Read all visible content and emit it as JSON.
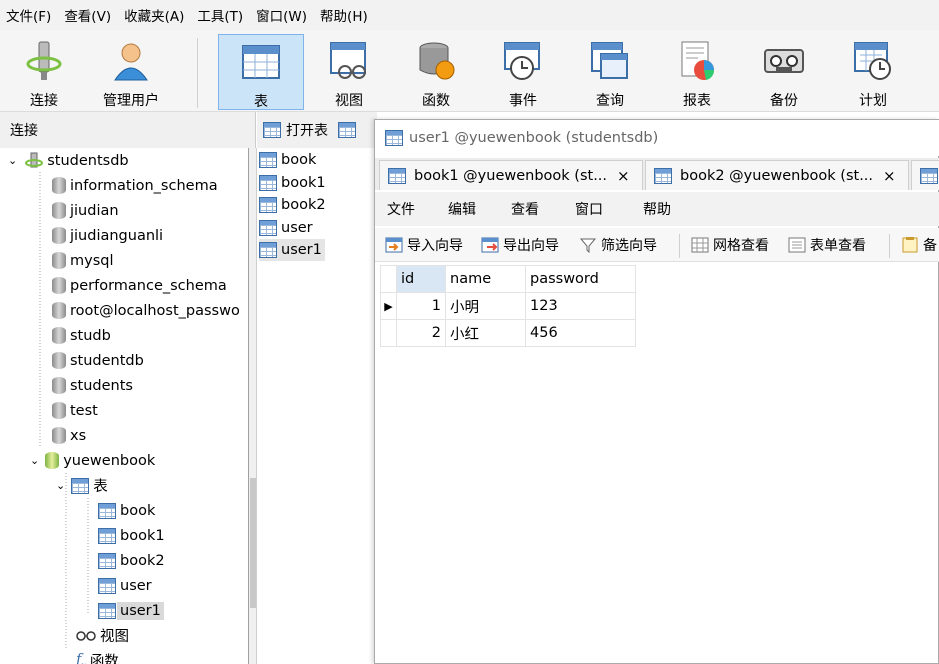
{
  "menubar": [
    "文件(F)",
    "查看(V)",
    "收藏夹(A)",
    "工具(T)",
    "窗口(W)",
    "帮助(H)"
  ],
  "toolbar": {
    "connect": "连接",
    "users": "管理用户",
    "table": "表",
    "view": "视图",
    "function": "函数",
    "event": "事件",
    "query": "查询",
    "report": "报表",
    "backup": "备份",
    "schedule": "计划"
  },
  "sidebar": {
    "header": "连接",
    "connection": "studentsdb",
    "databases": [
      "information_schema",
      "jiudian",
      "jiudianguanli",
      "mysql",
      "performance_schema",
      "root@localhost_passwo",
      "studb",
      "studentdb",
      "students",
      "test",
      "xs"
    ],
    "open_db": "yuewenbook",
    "tables_folder": "表",
    "tables": [
      "book",
      "book1",
      "book2",
      "user",
      "user1"
    ],
    "views_folder": "视图",
    "functions_folder": "函数"
  },
  "objbar": {
    "open_table": "打开表"
  },
  "objlist": [
    "book",
    "book1",
    "book2",
    "user",
    "user1"
  ],
  "window": {
    "title": "user1 @yuewenbook (studentsdb)",
    "tabs": [
      {
        "label": "book1 @yuewenbook (st..."
      },
      {
        "label": "book2 @yuewenbook (st..."
      }
    ],
    "tab_close": "×",
    "menu": [
      "文件",
      "编辑",
      "查看",
      "窗口",
      "帮助"
    ],
    "tools": {
      "import": "导入向导",
      "export": "导出向导",
      "filter": "筛选向导",
      "grid_view": "网格查看",
      "form_view": "表单查看",
      "more": "备"
    },
    "grid": {
      "columns": [
        "id",
        "name",
        "password"
      ],
      "rows": [
        [
          "1",
          "小明",
          "123"
        ],
        [
          "2",
          "小红",
          "456"
        ]
      ]
    }
  }
}
